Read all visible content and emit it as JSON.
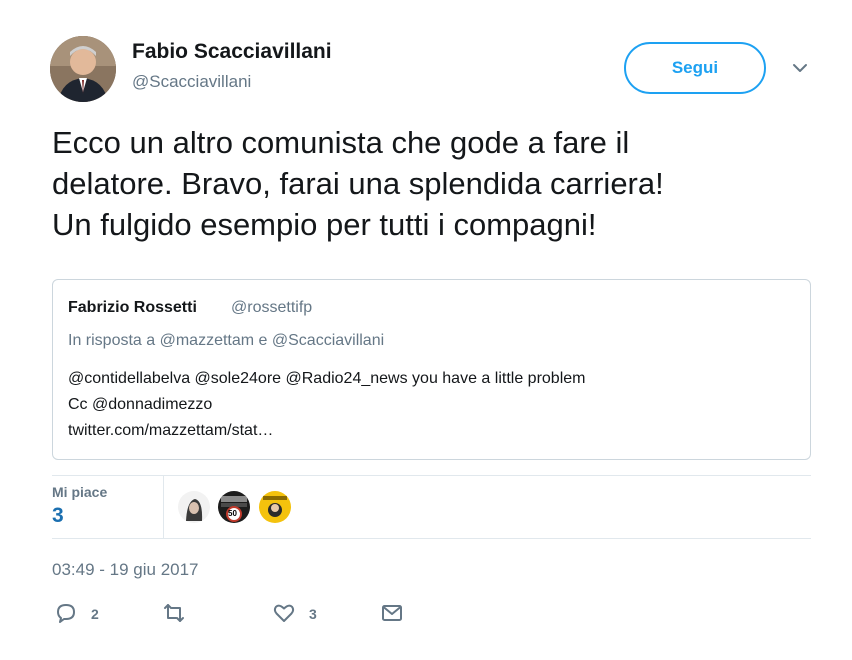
{
  "author": {
    "name": "Fabio Scacciavillani",
    "handle": "@Scacciavillani"
  },
  "follow_label": "Segui",
  "tweet_text": "Ecco un altro comunista che gode a fare il\ndelatore. Bravo, farai una splendida carriera!\nUn fulgido esempio per tutti i compagni!",
  "quoted": {
    "name": "Fabrizio Rossetti",
    "handle": "@rossettifp",
    "reply_to": "In risposta a @mazzettam e @Scacciavillani",
    "lines": [
      "@contidellabelva @sole24ore @Radio24_news you have a little problem",
      "Cc @donnadimezzo",
      "twitter.com/mazzettam/stat…"
    ]
  },
  "likes": {
    "label": "Mi piace",
    "count": "3"
  },
  "liker_badge": "50",
  "timestamp": "03:49 - 19 giu 2017",
  "actions": {
    "reply_count": "2",
    "retweet_count": "",
    "like_count": "3"
  },
  "colors": {
    "accent": "#1da1f2",
    "text": "#14171a",
    "muted": "#657786",
    "border": "#ccd6dd",
    "likes_count": "#1b6fb0"
  }
}
